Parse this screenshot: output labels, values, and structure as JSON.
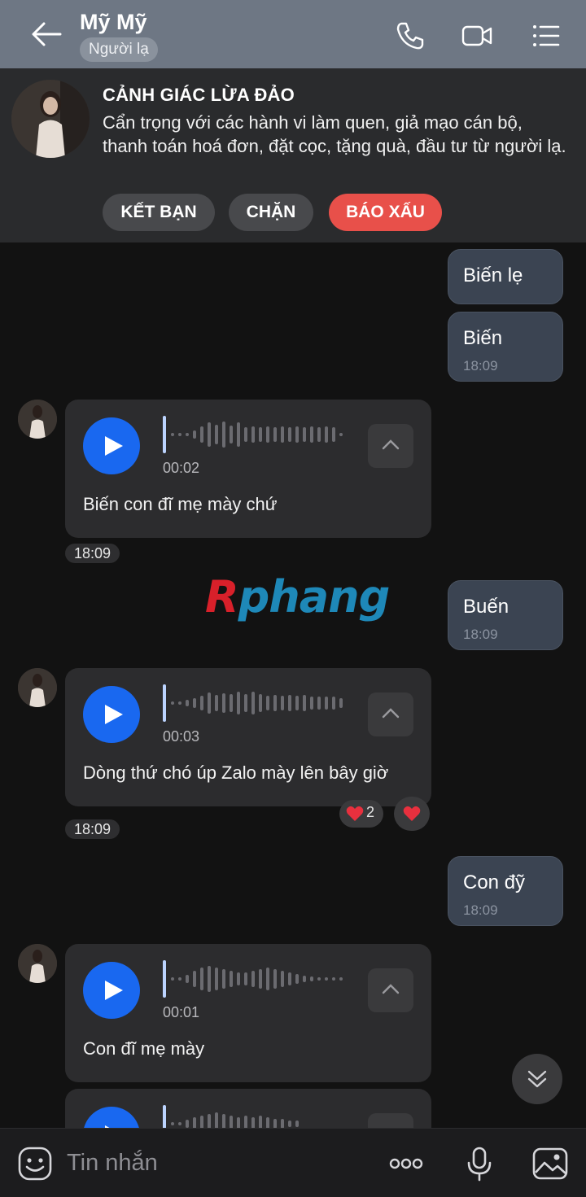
{
  "header": {
    "contact_name": "Mỹ Mỹ",
    "badge": "Người lạ",
    "icons": [
      "back-arrow-icon",
      "phone-icon",
      "video-call-icon",
      "menu-list-icon"
    ]
  },
  "warning": {
    "title": "CẢNH GIÁC LỪA ĐẢO",
    "text": "Cẩn trọng với các hành vi làm quen, giả mạo cán bộ, thanh toán hoá đơn, đặt cọc, tặng quà, đầu tư từ người lạ.",
    "buttons": {
      "add_friend": "KẾT BẠN",
      "block": "CHẶN",
      "report": "BÁO XẤU"
    }
  },
  "messages": {
    "out1": {
      "text": "Biến lẹ"
    },
    "out2": {
      "text": "Biến",
      "time": "18:09"
    },
    "voice1": {
      "duration": "00:02",
      "transcript": "Biến con đĩ mẹ mày chứ",
      "time": "18:09"
    },
    "out3": {
      "text": "Buến",
      "time": "18:09"
    },
    "voice2": {
      "duration": "00:03",
      "transcript": "Dòng thứ chó úp Zalo mày lên bây giờ",
      "time": "18:09",
      "reaction_count": "2"
    },
    "out4": {
      "text": "Con đỹ",
      "time": "18:09"
    },
    "voice3": {
      "duration": "00:01",
      "transcript": "Con đĩ mẹ mày"
    }
  },
  "watermark": {
    "first": "R",
    "rest": "phang"
  },
  "composer": {
    "placeholder": "Tin nhắn"
  },
  "colors": {
    "header": "#6e7784",
    "accent": "#1968f0",
    "report": "#e8504a",
    "outgoing_bubble": "#3b4452"
  }
}
